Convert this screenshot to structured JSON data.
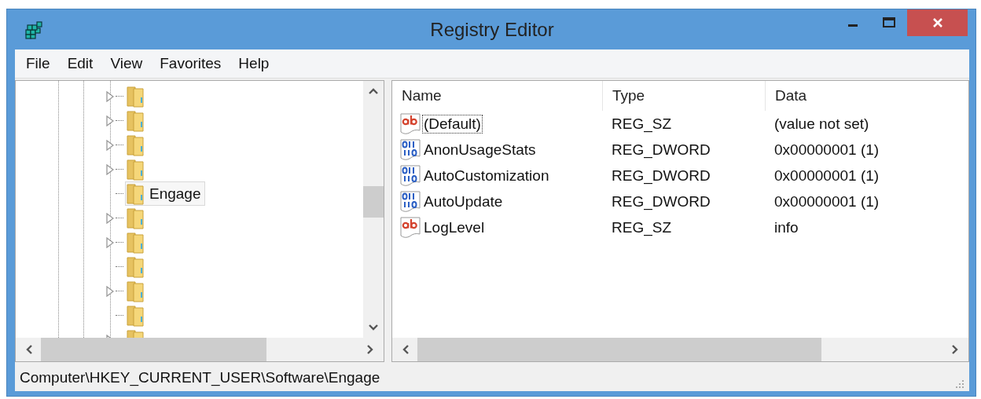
{
  "window": {
    "title": "Registry Editor"
  },
  "menu": [
    {
      "label": "File"
    },
    {
      "label": "Edit"
    },
    {
      "label": "View"
    },
    {
      "label": "Favorites"
    },
    {
      "label": "Help"
    }
  ],
  "tree": {
    "items": [
      {
        "expandable": true,
        "selected": false
      },
      {
        "expandable": true,
        "selected": false
      },
      {
        "expandable": true,
        "selected": false
      },
      {
        "expandable": true,
        "selected": false
      },
      {
        "label": "Engage",
        "expandable": false,
        "selected": true
      },
      {
        "expandable": true,
        "selected": false
      },
      {
        "expandable": true,
        "selected": false
      },
      {
        "expandable": false,
        "selected": false
      },
      {
        "expandable": true,
        "selected": false
      },
      {
        "expandable": false,
        "selected": false
      },
      {
        "expandable": true,
        "selected": false
      }
    ]
  },
  "values": {
    "columns": [
      "Name",
      "Type",
      "Data"
    ],
    "rows": [
      {
        "kind": "string",
        "name": "(Default)",
        "type": "REG_SZ",
        "data": "(value not set)",
        "focused": true
      },
      {
        "kind": "binary",
        "name": "AnonUsageStats",
        "type": "REG_DWORD",
        "data": "0x00000001 (1)",
        "focused": false
      },
      {
        "kind": "binary",
        "name": "AutoCustomization",
        "type": "REG_DWORD",
        "data": "0x00000001 (1)",
        "focused": false
      },
      {
        "kind": "binary",
        "name": "AutoUpdate",
        "type": "REG_DWORD",
        "data": "0x00000001 (1)",
        "focused": false
      },
      {
        "kind": "string",
        "name": "LogLevel",
        "type": "REG_SZ",
        "data": "info",
        "focused": false
      }
    ]
  },
  "status_bar": "Computer\\HKEY_CURRENT_USER\\Software\\Engage"
}
